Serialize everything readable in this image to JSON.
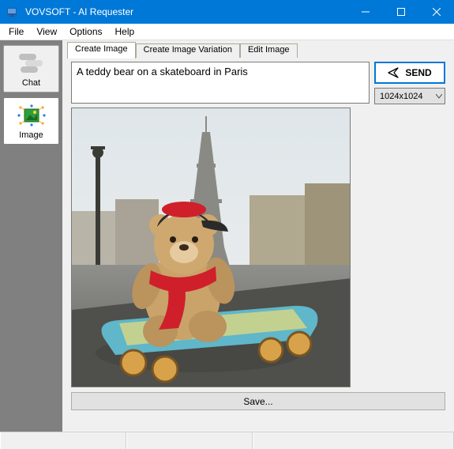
{
  "window": {
    "title": "VOVSOFT - AI Requester"
  },
  "menu": {
    "file": "File",
    "view": "View",
    "options": "Options",
    "help": "Help"
  },
  "sidebar": {
    "chat": "Chat",
    "image": "Image"
  },
  "tabs": {
    "create": "Create Image",
    "variation": "Create Image Variation",
    "edit": "Edit Image"
  },
  "prompt": {
    "value": "A teddy bear on a skateboard in Paris"
  },
  "buttons": {
    "send": "SEND",
    "save": "Save..."
  },
  "size_select": {
    "value": "1024x1024"
  }
}
